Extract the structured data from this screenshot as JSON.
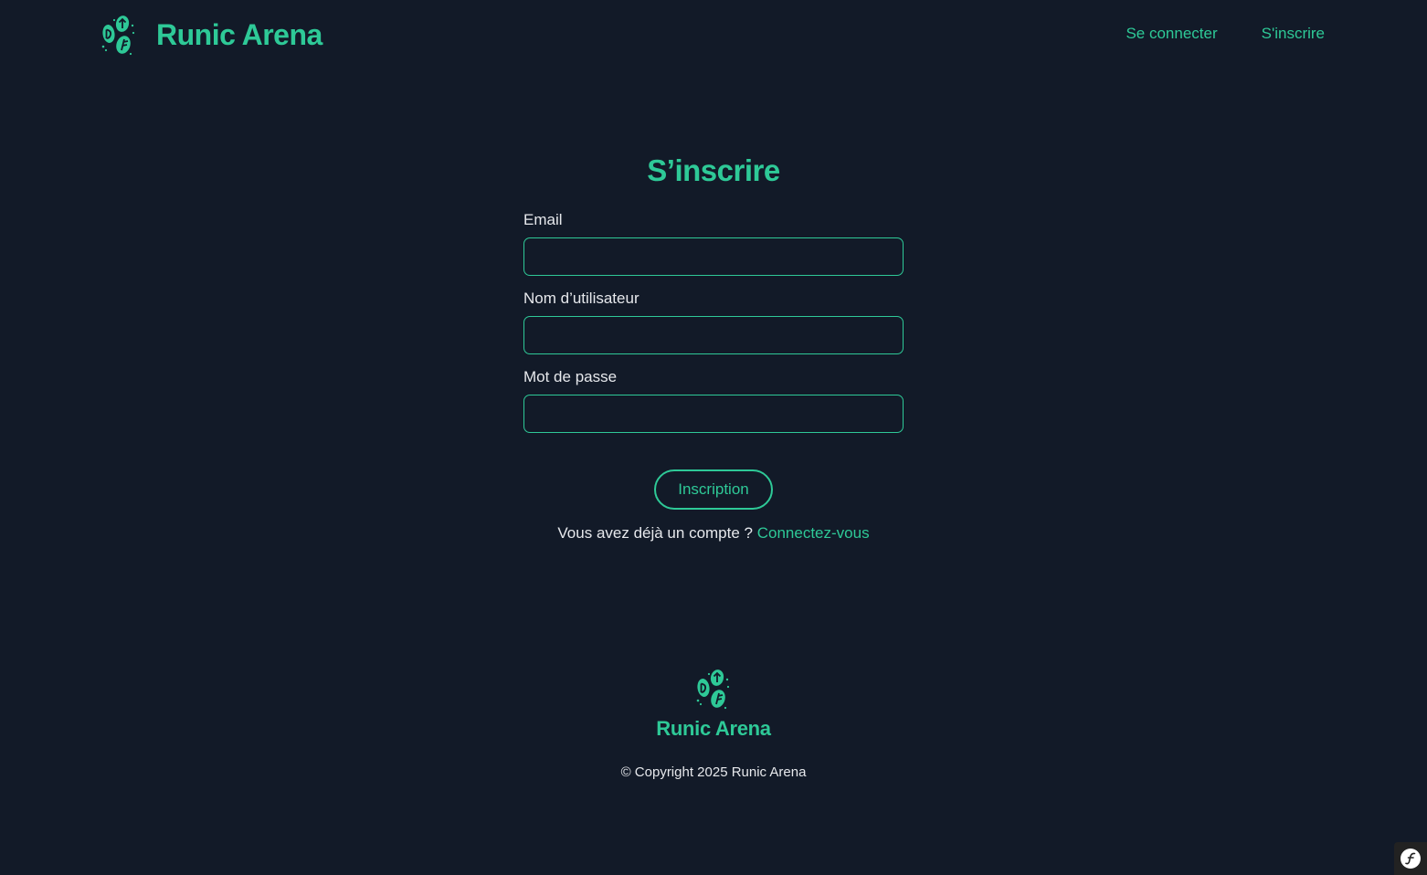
{
  "header": {
    "brand_name": "Runic Arena",
    "nav": {
      "login_label": "Se connecter",
      "register_label": "S'inscrire"
    }
  },
  "form": {
    "title": "S’inscrire",
    "email": {
      "label": "Email",
      "value": ""
    },
    "username": {
      "label": "Nom d’utilisateur",
      "value": ""
    },
    "password": {
      "label": "Mot de passe",
      "value": ""
    },
    "submit_label": "Inscription",
    "prompt_text": "Vous avez déjà un compte ?",
    "prompt_link": "Connectez-vous"
  },
  "footer": {
    "brand_name": "Runic Arena",
    "copyright": "© Copyright 2025 Runic Arena"
  },
  "icons": {
    "logo": "runic-stones-logo-icon",
    "debug_toolbar": "symfony-icon"
  },
  "colors": {
    "background": "#121a28",
    "accent": "#2ec997",
    "text": "#e6e8ec"
  }
}
